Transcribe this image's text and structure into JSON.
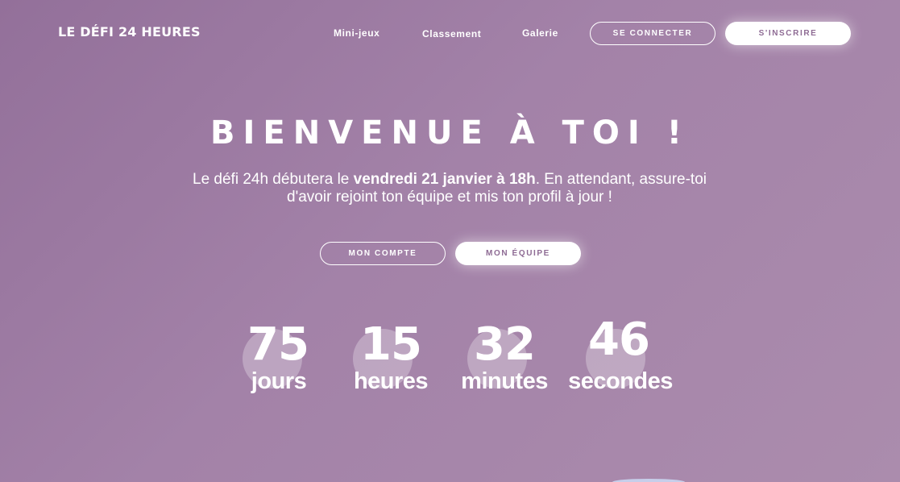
{
  "header": {
    "logo": "LE DÉFI 24 HEURES",
    "nav": {
      "mini_jeux": "Mini-jeux",
      "classement": "Classement",
      "galerie": "Galerie"
    },
    "login_button": "SE CONNECTER",
    "signup_button": "S'INSCRIRE"
  },
  "hero": {
    "title": "BIENVENUE À TOI !",
    "text_before": "Le défi 24h débutera le ",
    "text_bold": "vendredi 21 janvier à 18h",
    "text_after": ". En attendant, assure-toi d'avoir rejoint ton équipe et mis ton profil à jour !",
    "account_button": "MON COMPTE",
    "team_button": "MON ÉQUIPE"
  },
  "countdown": {
    "days": {
      "value": "75",
      "label": "jours"
    },
    "hours": {
      "value": "15",
      "label": "heures"
    },
    "minutes": {
      "value": "32",
      "label": "minutes"
    },
    "seconds": {
      "value": "46",
      "label": "secondes"
    }
  },
  "colors": {
    "background_start": "#93709a",
    "background_end": "#ab8cad",
    "accent_text": "#8e6b94"
  }
}
